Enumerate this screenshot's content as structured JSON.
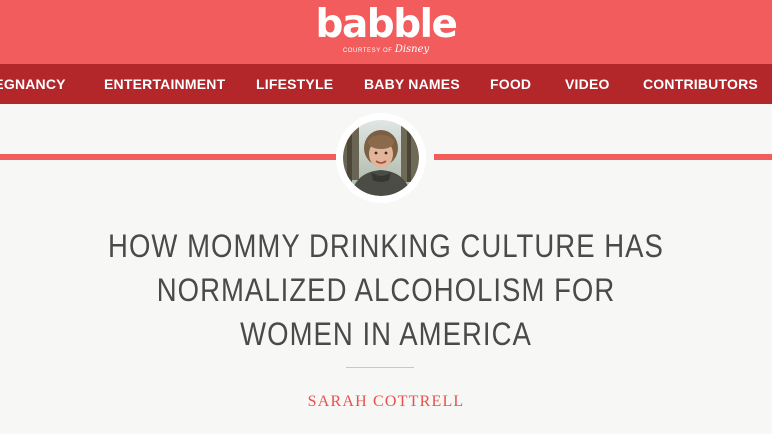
{
  "header": {
    "logo_text": "babble",
    "logo_tagline_prefix": "COURTESY OF",
    "logo_tagline_brand": "Disney",
    "background_color": "#f25c5c"
  },
  "nav": {
    "background_color": "#b3262a",
    "items": [
      {
        "label": "REGNANCY"
      },
      {
        "label": "ENTERTAINMENT"
      },
      {
        "label": "LIFESTYLE"
      },
      {
        "label": "BABY NAMES"
      },
      {
        "label": "FOOD"
      },
      {
        "label": "VIDEO"
      },
      {
        "label": "CONTRIBUTORS"
      }
    ]
  },
  "article": {
    "headline": "HOW MOMMY DRINKING CULTURE HAS NORMALIZED ALCOHOLISM FOR WOMEN IN AMERICA",
    "author": "SARAH COTTRELL",
    "accent_color": "#f25c5c",
    "author_color": "#e8504d"
  },
  "icons": {
    "author_avatar": "author-photo"
  }
}
